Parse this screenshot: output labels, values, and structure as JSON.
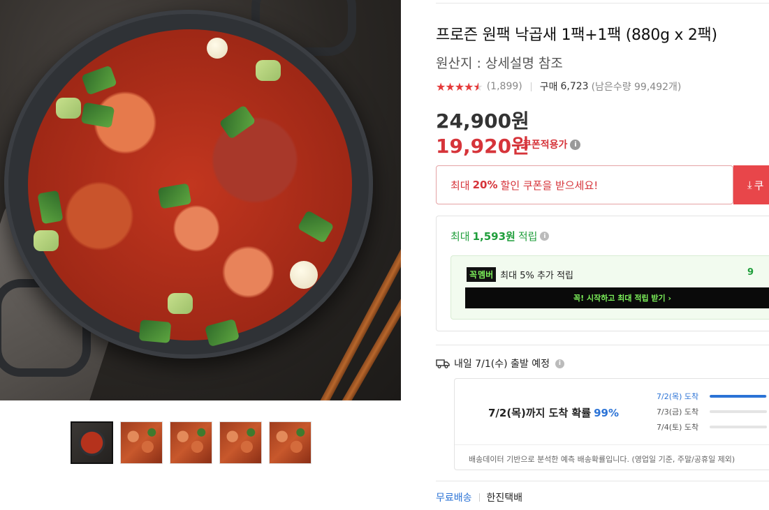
{
  "product": {
    "title": "프로즌 원팩 낙곱새 1팩+1팩 (880g x 2팩)",
    "origin": "원산지 : 상세설명 참조",
    "rating": 4.5,
    "review_count": "(1,899)",
    "purchase_label": "구매",
    "purchase_count": "6,723",
    "remaining": "(남은수량 99,492개)"
  },
  "price": {
    "original": "24,900원",
    "sale": "19,920원",
    "coupon_label": "쿠폰적용가"
  },
  "coupon": {
    "prefix": "최대",
    "percent": "20%",
    "suffix": "할인 쿠폰을 받으세요!",
    "button_label": "쿠"
  },
  "points": {
    "prefix": "최대",
    "amount": "1,593원",
    "suffix": "적립",
    "member_badge_1": "꼭",
    "member_badge_2": "멤버",
    "member_text": "최대 5% 추가 적립",
    "member_percent": "9",
    "member_cta": "꼭! 시작하고 최대 적립 받기 ›"
  },
  "shipping": {
    "departure": "내일 7/1(수) 출발 예정",
    "headline": "7/2(목)까지 도착 확률",
    "headline_percent": "99%",
    "rows": [
      {
        "label": "7/2(목) 도착",
        "fraction": 0.99
      },
      {
        "label": "7/3(금) 도착",
        "fraction": 0.0
      },
      {
        "label": "7/4(토) 도착",
        "fraction": 0.0
      }
    ],
    "note": "배송데이터 기반으로 분석한 예측 배송확률입니다. (영업일 기준, 주말/공휴일 제외)",
    "free_label": "무료배송",
    "courier": "한진택배"
  },
  "colors": {
    "sale_red": "#d6343a",
    "points_green": "#1f9e3b",
    "eta_blue": "#2b73d6"
  },
  "icons": {
    "info": "info-circle-icon",
    "truck": "truck-icon",
    "download": "download-arrow-icon"
  }
}
